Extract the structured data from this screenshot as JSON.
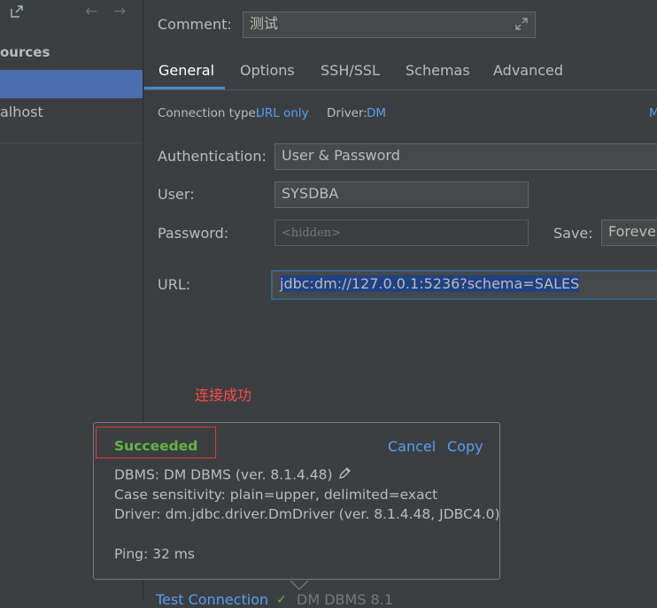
{
  "sidebar": {
    "header_label": "ources",
    "items": [
      {
        "label": ""
      },
      {
        "label": "alhost"
      }
    ]
  },
  "comment": {
    "label": "Comment:",
    "value": "测试"
  },
  "tabs": [
    {
      "label": "General",
      "active": true
    },
    {
      "label": "Options"
    },
    {
      "label": "SSH/SSL"
    },
    {
      "label": "Schemas"
    },
    {
      "label": "Advanced"
    }
  ],
  "connection": {
    "type_label": "Connection type:",
    "type_value": "URL only",
    "driver_label": "Driver:",
    "driver_value": "DM",
    "edge_link": "M"
  },
  "form": {
    "auth_label": "Authentication:",
    "auth_value": "User & Password",
    "user_label": "User:",
    "user_value": "SYSDBA",
    "password_label": "Password:",
    "password_placeholder": "<hidden>",
    "save_label": "Save:",
    "save_value": "Forever",
    "url_label": "URL:",
    "url_value": "jdbc:dm://127.0.0.1:5236?schema=SALES"
  },
  "annotation": {
    "text": "连接成功",
    "color": "#ff4b4b"
  },
  "popup": {
    "status": "Succeeded",
    "cancel": "Cancel",
    "copy": "Copy",
    "dbms": "DBMS: DM DBMS (ver. 8.1.4.48)",
    "case": "Case sensitivity: plain=upper, delimited=exact",
    "driver": "Driver: dm.jdbc.driver.DmDriver (ver. 8.1.4.48, JDBC4.0)",
    "ping": "Ping: 32 ms"
  },
  "footer": {
    "test_connection": "Test Connection",
    "status": "DM DBMS 8.1"
  },
  "colors": {
    "accent": "#589df6",
    "success": "#62b543",
    "selection": "#4b6eaf",
    "annotation_box": "#e53935"
  }
}
